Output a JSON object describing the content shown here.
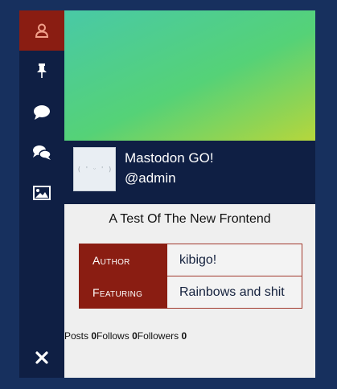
{
  "sidebar": {
    "items": [
      {
        "icon": "user-icon",
        "active": true
      },
      {
        "icon": "pin-icon",
        "active": false
      },
      {
        "icon": "speech-bubble-icon",
        "active": false
      },
      {
        "icon": "conversation-icon",
        "active": false
      },
      {
        "icon": "image-icon",
        "active": false
      },
      {
        "icon": "close-icon",
        "active": false
      }
    ]
  },
  "colors": {
    "page_background": "#17305e",
    "sidebar": "#0f1f44",
    "accent": "#8a1d12",
    "banner_start": "#49c9a6",
    "banner_end": "#b6d63c"
  },
  "profile": {
    "avatar_text": "( ' ᵕ ' )",
    "display_name": "Mastodon GO!",
    "handle": "@admin",
    "bio": "A Test Of The New Frontend",
    "fields": [
      {
        "name": "Author",
        "value": "kibigo!"
      },
      {
        "name": "Featuring",
        "value": "Rainbows and shit"
      }
    ],
    "stats": {
      "posts_label": "Posts",
      "posts_count": "0",
      "follows_label": "Follows",
      "follows_count": "0",
      "followers_label": "Followers",
      "followers_count": "0"
    }
  }
}
